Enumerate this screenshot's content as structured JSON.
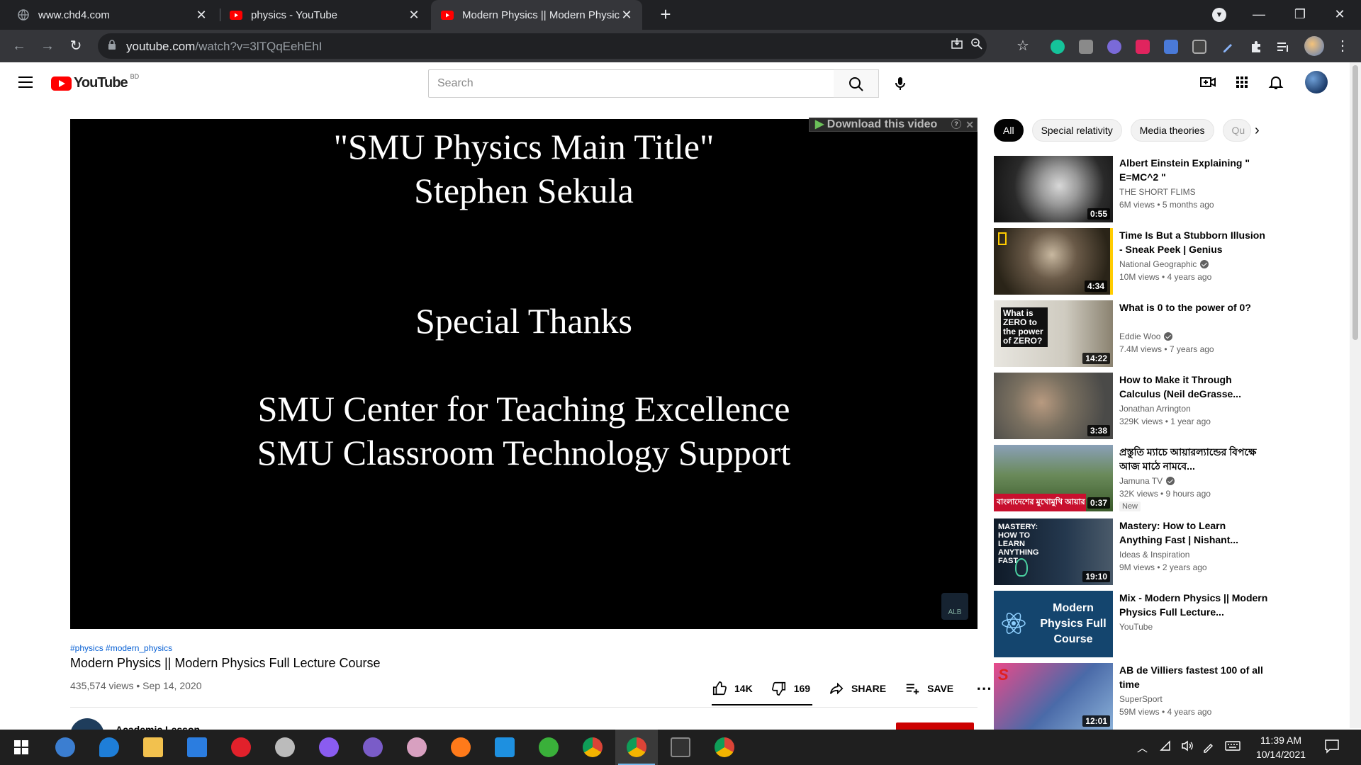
{
  "browser": {
    "tabs": [
      {
        "title": "www.chd4.com",
        "icon": "globe-icon"
      },
      {
        "title": "physics - YouTube",
        "icon": "youtube-icon"
      },
      {
        "title": "Modern Physics || Modern Physic",
        "icon": "youtube-icon"
      }
    ],
    "active_tab": 2,
    "url_host": "youtube.com",
    "url_path": "/watch?v=3lTQqEehEhI"
  },
  "youtube": {
    "logo_text": "YouTube",
    "region": "BD",
    "search_placeholder": "Search"
  },
  "player": {
    "lines": [
      "\"SMU Physics Main Title\"",
      "Stephen Sekula",
      "Special Thanks",
      "SMU Center for Teaching Excellence",
      "SMU Classroom Technology Support"
    ],
    "download_bar": "Download this video",
    "watermark": "ALB"
  },
  "video": {
    "tags": "#physics #modern_physics",
    "title": "Modern Physics || Modern Physics Full Lecture Course",
    "meta": "435,574 views • Sep 14, 2020",
    "likes": "14K",
    "dislikes": "169",
    "share": "SHARE",
    "save": "SAVE",
    "channel": "Academic Lesson"
  },
  "chips": [
    "All",
    "Special relativity",
    "Media theories",
    "Qu"
  ],
  "recommendations": [
    {
      "title": "Albert Einstein Explaining \" E=MC^2 \"",
      "channel": "THE SHORT FLIMS",
      "verified": false,
      "meta": "6M views • 5 months ago",
      "duration": "0:55",
      "badge": "",
      "thumb": "#3a3a3a"
    },
    {
      "title": "Time Is But a Stubborn Illusion - Sneak Peek | Genius",
      "channel": "National Geographic",
      "verified": true,
      "meta": "10M views • 4 years ago",
      "duration": "4:34",
      "badge": "",
      "thumb": "#4a4436"
    },
    {
      "title": "What is 0 to the power of 0?",
      "channel": "Eddie Woo",
      "verified": true,
      "meta": "7.4M views • 7 years ago",
      "duration": "14:22",
      "badge": "",
      "thumb": "#d8d4c8",
      "overlay": "What is ZERO to the power of ZERO?"
    },
    {
      "title": "How to Make it Through Calculus (Neil deGrasse...",
      "channel": "Jonathan Arrington",
      "verified": false,
      "meta": "329K views • 1 year ago",
      "duration": "3:38",
      "badge": "",
      "thumb": "#6b6458"
    },
    {
      "title": "প্রস্তুতি ম্যাচে আয়ারল্যান্ডের বিপক্ষে আজ মাঠে নামবে...",
      "channel": "Jamuna TV",
      "verified": true,
      "meta": "32K views • 9 hours ago",
      "duration": "0:37",
      "badge": "New",
      "thumb": "#5d7a4a",
      "overlay": "বাংলাদেশের মুখোমুখি আয়ার"
    },
    {
      "title": "Mastery: How to Learn Anything Fast | Nishant...",
      "channel": "Ideas & Inspiration",
      "verified": false,
      "meta": "9M views • 2 years ago",
      "duration": "19:10",
      "badge": "",
      "thumb": "#1c2a3a",
      "overlay": "MASTERY: HOW TO LEARN ANYTHING FAST"
    },
    {
      "title": "Mix - Modern Physics || Modern Physics Full Lecture...",
      "channel": "YouTube",
      "verified": false,
      "meta": "",
      "duration": "",
      "badge": "",
      "thumb": "#123d5e",
      "overlay": "Modern Physics Full Course"
    },
    {
      "title": "AB de Villiers fastest 100 of all time",
      "channel": "SuperSport",
      "verified": false,
      "meta": "59M views • 4 years ago",
      "duration": "12:01",
      "badge": "",
      "thumb": "#3a5a8a"
    }
  ],
  "taskbar": {
    "time": "11:39 AM",
    "date": "10/14/2021"
  }
}
